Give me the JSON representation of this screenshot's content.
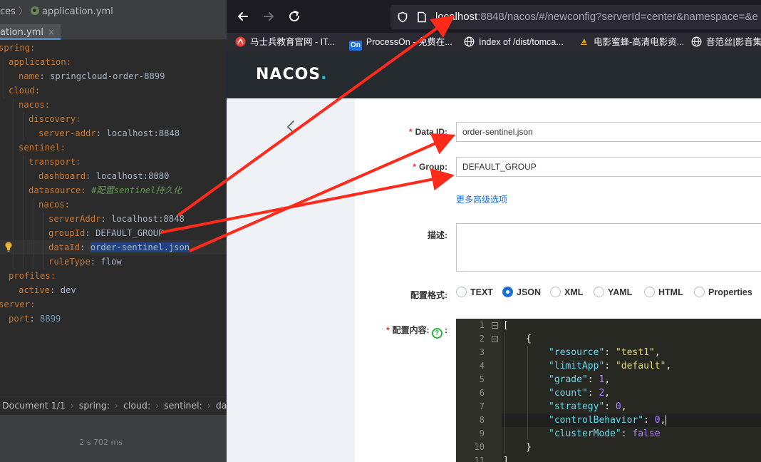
{
  "ide": {
    "breadcrumb_prev": "ces",
    "breadcrumb_file": "application.yml",
    "tab_label": "ation.yml",
    "tab_close": "×",
    "code": {
      "l1": "spring:",
      "l2": "application:",
      "l3_key": "name",
      "l3_val": "springcloud-order-8899",
      "l4": "cloud:",
      "l5": "nacos:",
      "l6": "discovery:",
      "l7_key": "server-addr",
      "l7_val": "localhost:8848",
      "l8": "sentinel:",
      "l9": "transport:",
      "l10_key": "dashboard",
      "l10_val": "localhost:8080",
      "l11_key": "datasource:",
      "l11_comment": "#配置sentinel持久化",
      "l12": "nacos:",
      "l13_key": "serverAddr",
      "l13_val": "localhost:8848",
      "l14_key": "groupId",
      "l14_val": "DEFAULT_GROUP",
      "l15_key": "dataId",
      "l15_val": "order-sentinel.json",
      "l16_key": "ruleType",
      "l16_val": "flow",
      "l17": "profiles:",
      "l18_key": "active",
      "l18_val": "dev",
      "l19": "server:",
      "l20_key": "port",
      "l20_val": "8899"
    },
    "status_crumbs": [
      "Document 1/1",
      "spring:",
      "cloud:",
      "sentinel:",
      "da"
    ],
    "elapsed": "2 s 702 ms"
  },
  "browser": {
    "url_host": "localhost",
    "url_rest": ":8848/nacos/#/newconfig?serverId=center&namespace=&e",
    "bookmarks": [
      "马士兵教育官网 - IT...",
      "ProcessOn - 免费在...",
      "Index of /dist/tomca...",
      "电影蜜蜂-高清电影资...",
      "音范丝|影音集"
    ],
    "bookmark_on_badge": "On"
  },
  "nacos": {
    "logo_main": "NACOS",
    "logo_dot": ".",
    "form": {
      "data_id_label": "Data ID:",
      "data_id_value": "order-sentinel.json",
      "group_label": "Group:",
      "group_value": "DEFAULT_GROUP",
      "advanced_link": "更多高级选项",
      "desc_label": "描述:",
      "format_label": "配置格式:",
      "formats": [
        "TEXT",
        "JSON",
        "XML",
        "YAML",
        "HTML",
        "Properties"
      ],
      "selected_format": "JSON",
      "content_label": "配置内容:",
      "help_glyph": "?",
      "required_mark": "*"
    },
    "editor": {
      "line_numbers": [
        "1",
        "2",
        "3",
        "4",
        "5",
        "6",
        "7",
        "8",
        "9",
        "10",
        "11"
      ],
      "json": [
        {
          "k": "resource",
          "v": "\"test1\"",
          "t": "s"
        },
        {
          "k": "limitApp",
          "v": "\"default\"",
          "t": "s"
        },
        {
          "k": "grade",
          "v": "1",
          "t": "n"
        },
        {
          "k": "count",
          "v": "2",
          "t": "n"
        },
        {
          "k": "strategy",
          "v": "0",
          "t": "n"
        },
        {
          "k": "controlBehavior",
          "v": "0",
          "t": "n"
        },
        {
          "k": "clusterMode",
          "v": "false",
          "t": "b"
        }
      ]
    }
  },
  "colors": {
    "arrow": "#ff2a1a",
    "link": "#1a6fd8",
    "required": "#e53935"
  }
}
